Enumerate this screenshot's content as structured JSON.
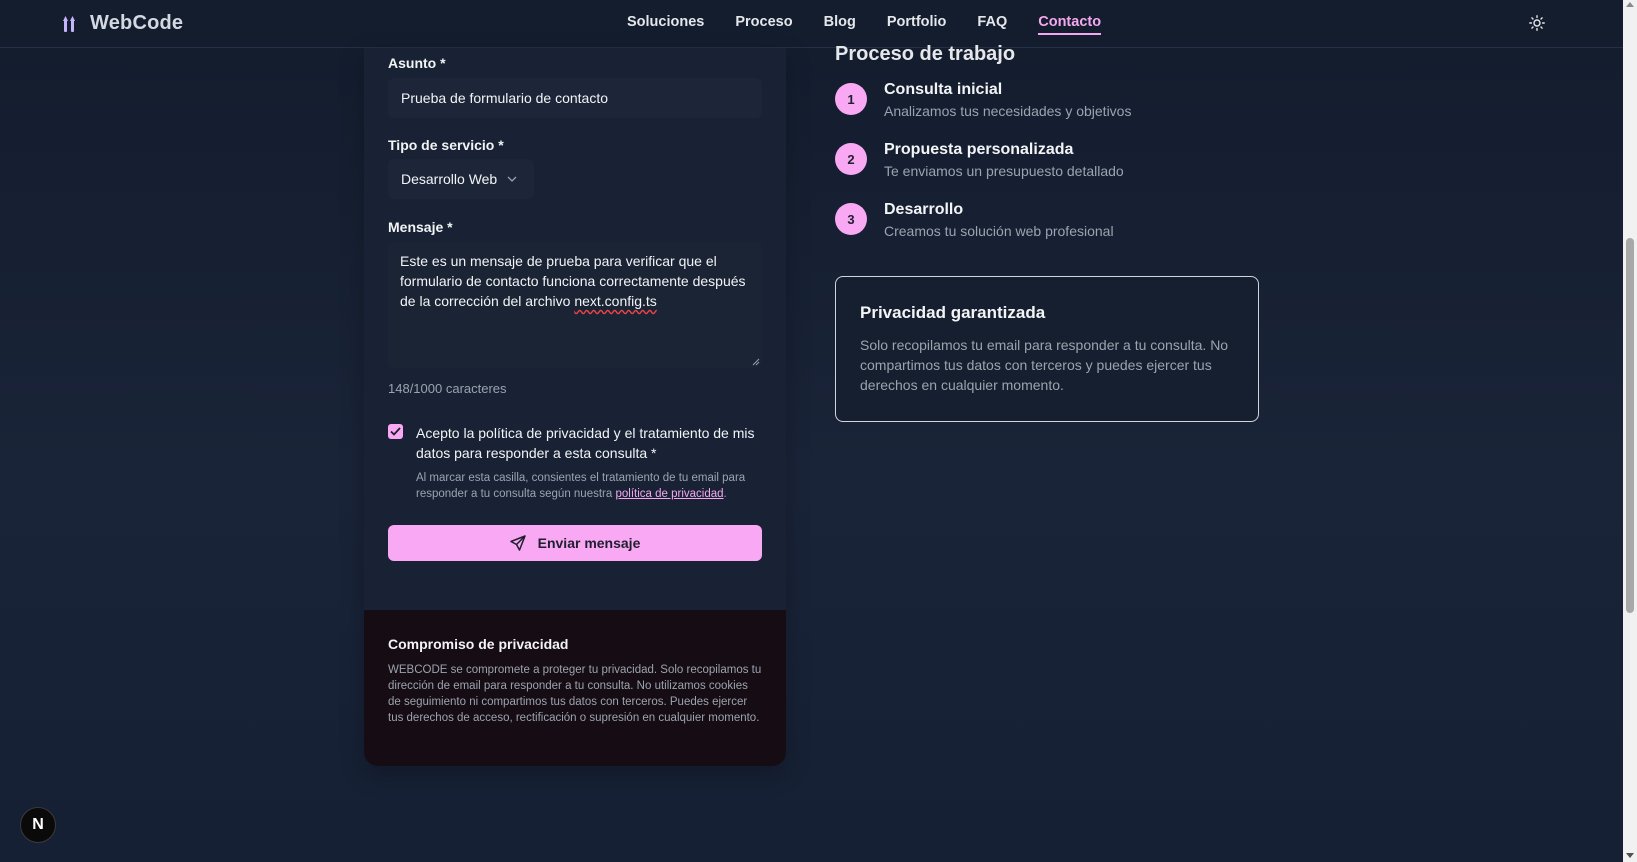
{
  "header": {
    "logo_text": "WebCode",
    "nav": [
      {
        "label": "Soluciones",
        "active": false
      },
      {
        "label": "Proceso",
        "active": false
      },
      {
        "label": "Blog",
        "active": false
      },
      {
        "label": "Portfolio",
        "active": false
      },
      {
        "label": "FAQ",
        "active": false
      },
      {
        "label": "Contacto",
        "active": true
      }
    ],
    "theme_icon": "sun-icon"
  },
  "form": {
    "subject_label": "Asunto *",
    "subject_value": "Prueba de formulario de contacto",
    "service_label": "Tipo de servicio *",
    "service_value": "Desarrollo Web",
    "message_label": "Mensaje *",
    "message_text": "Este es un mensaje de prueba para verificar que el formulario de contacto funciona correctamente después de la corrección del archivo ",
    "message_misspelled": "next.config.ts",
    "char_counter": "148/1000 caracteres",
    "consent_checked": true,
    "consent_label": "Acepto la política de privacidad y el tratamiento de mis datos para responder a esta consulta *",
    "consent_note_prefix": "Al marcar esta casilla, consientes el tratamiento de tu email para responder a tu consulta según nuestra ",
    "consent_note_link": "política de privacidad",
    "consent_note_suffix": ".",
    "submit_label": "Enviar mensaje"
  },
  "privacy_footer": {
    "title": "Compromiso de privacidad",
    "text": "WEBCODE se compromete a proteger tu privacidad. Solo recopilamos tu dirección de email para responder a tu consulta. No utilizamos cookies de seguimiento ni compartimos tus datos con terceros. Puedes ejercer tus derechos de acceso, rectificación o supresión en cualquier momento."
  },
  "process": {
    "title": "Proceso de trabajo",
    "steps": [
      {
        "num": "1",
        "title": "Consulta inicial",
        "desc": "Analizamos tus necesidades y objetivos"
      },
      {
        "num": "2",
        "title": "Propuesta personalizada",
        "desc": "Te enviamos un presupuesto detallado"
      },
      {
        "num": "3",
        "title": "Desarrollo",
        "desc": "Creamos tu solución web profesional"
      }
    ]
  },
  "guarantee": {
    "title": "Privacidad garantizada",
    "text": "Solo recopilamos tu email para responder a tu consulta. No compartimos tus datos con terceros y puedes ejercer tus derechos en cualquier momento."
  },
  "dev_badge": "N",
  "colors": {
    "accent": "#f9a8f4",
    "background": "#182234",
    "header": "#141d2d"
  }
}
